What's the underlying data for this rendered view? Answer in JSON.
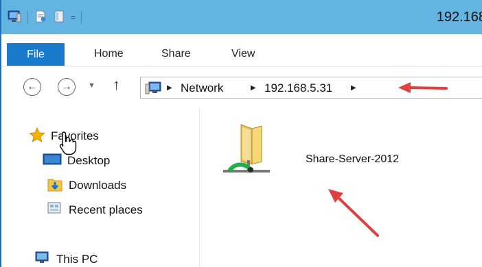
{
  "window": {
    "title": "192.168"
  },
  "quick_access": {
    "dropdown_glyph": "="
  },
  "ribbon": {
    "tabs": [
      {
        "label": "File"
      },
      {
        "label": "Home"
      },
      {
        "label": "Share"
      },
      {
        "label": "View"
      }
    ]
  },
  "address_bar": {
    "crumbs": [
      "Network",
      "192.168.5.31"
    ]
  },
  "nav_pane": {
    "items": [
      {
        "label": "Favorites",
        "icon": "star-icon"
      },
      {
        "label": "Desktop",
        "icon": "desktop-icon"
      },
      {
        "label": "Downloads",
        "icon": "downloads-folder-icon"
      },
      {
        "label": "Recent places",
        "icon": "recent-places-icon"
      },
      {
        "label": "This PC",
        "icon": "computer-icon"
      }
    ]
  },
  "content": {
    "items": [
      {
        "label": "Share-Server-2012",
        "icon": "network-share-folder-icon"
      }
    ]
  },
  "colors": {
    "titlebar": "#63b3e3",
    "file_tab": "#1979ca",
    "annotation_arrow": "#e04040"
  }
}
